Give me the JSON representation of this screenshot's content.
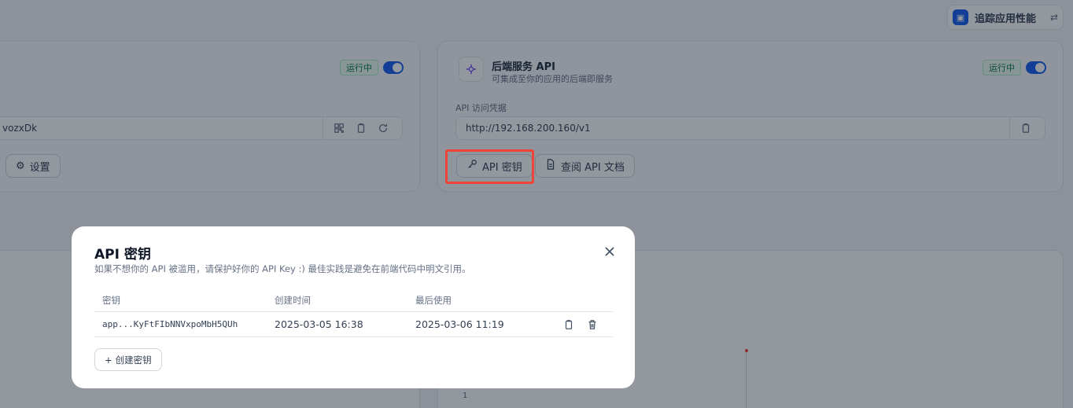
{
  "app": {
    "name": "追踪应用性能"
  },
  "web_card": {
    "status": "运行中",
    "url_partial": "vozxDk",
    "settings_label": "设置"
  },
  "api_card": {
    "title": "后端服务 API",
    "description": "可集成至你的应用的后端即服务",
    "status": "运行中",
    "field_label": "API 访问凭据",
    "url": "http://192.168.200.160/v1",
    "api_key_button": "API 密钥",
    "docs_button": "查阅 API 文档"
  },
  "chart_bg": {
    "tick": "1"
  },
  "modal": {
    "title": "API 密钥",
    "description": "如果不想你的 API 被滥用，请保护好你的 API Key :) 最佳实践是避免在前端代码中明文引用。",
    "columns": {
      "key": "密钥",
      "created": "创建时间",
      "last_used": "最后使用"
    },
    "rows": [
      {
        "key": "app...KyFtFIbNNVxpoMbH5QUh",
        "created": "2025-03-05 16:38",
        "last_used": "2025-03-06 11:19"
      }
    ],
    "create_button": "创建密钥"
  },
  "colors": {
    "primary": "#155eef",
    "status_green": "#067647",
    "highlight": "#f04438"
  }
}
